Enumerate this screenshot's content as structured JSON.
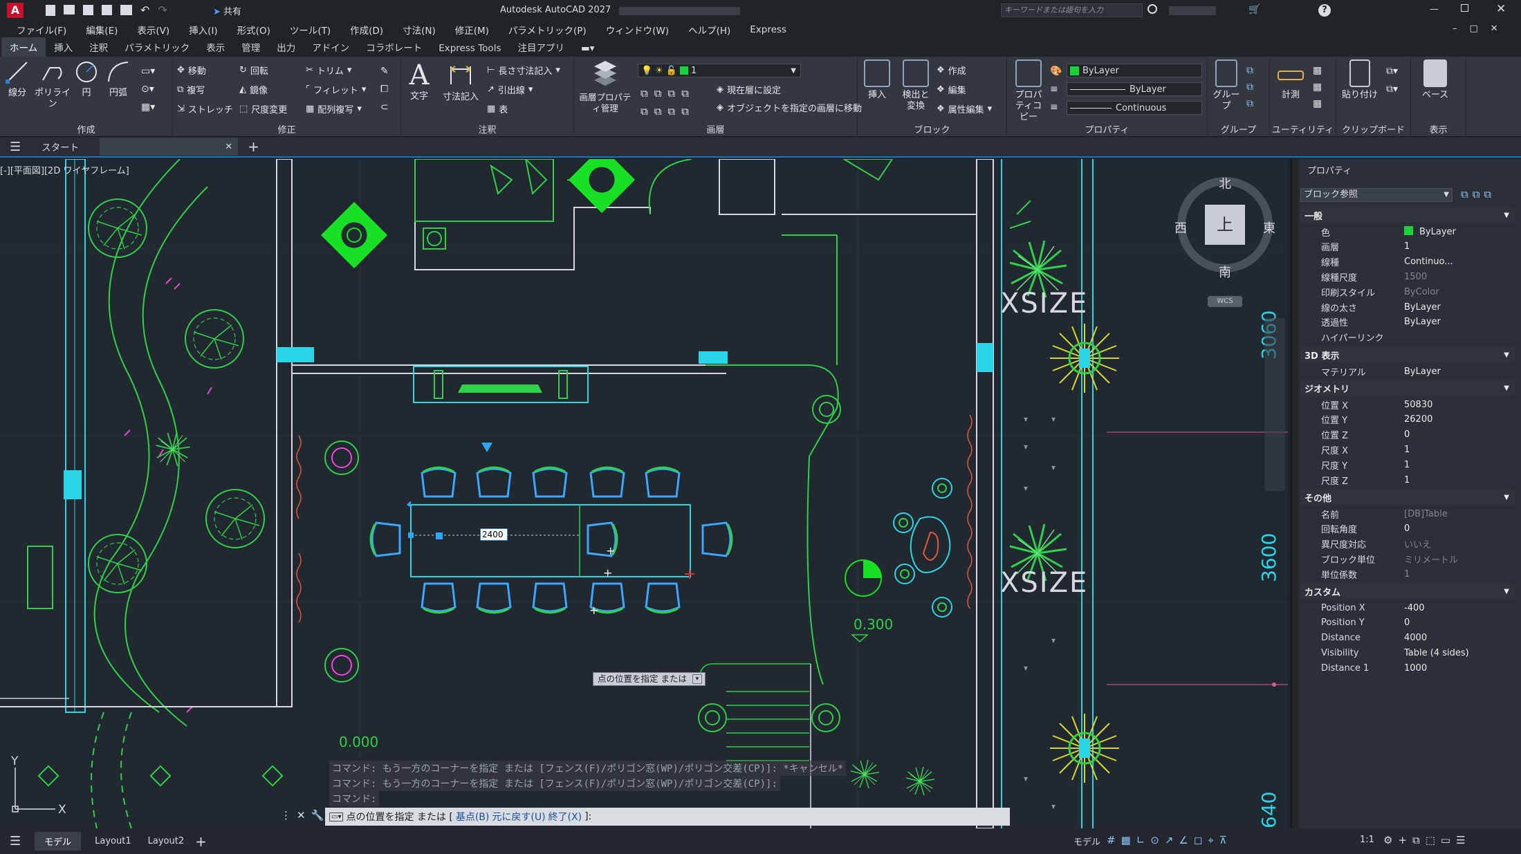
{
  "app_title": "Autodesk AutoCAD 2027",
  "share_label": "共有",
  "search_placeholder": "キーワードまたは語句を入力",
  "menu": [
    "ファイル(F)",
    "編集(E)",
    "表示(V)",
    "挿入(I)",
    "形式(O)",
    "ツール(T)",
    "作成(D)",
    "寸法(N)",
    "修正(M)",
    "パラメトリック(P)",
    "ウィンドウ(W)",
    "ヘルプ(H)",
    "Express"
  ],
  "ribbon_tabs": [
    "ホーム",
    "挿入",
    "注釈",
    "パラメトリック",
    "表示",
    "管理",
    "出力",
    "アドイン",
    "コラボレート",
    "Express Tools",
    "注目アプリ"
  ],
  "ribbon": {
    "draw": {
      "title": "作成",
      "line": "線分",
      "polyline": "ポリライン",
      "circle": "円",
      "arc": "円弧"
    },
    "modify": {
      "title": "修正",
      "move": "移動",
      "rotate": "回転",
      "trim": "トリム",
      "copy": "複写",
      "mirror": "鏡像",
      "fillet": "フィレット",
      "stretch": "ストレッチ",
      "scale": "尺度変更",
      "array": "配列複写"
    },
    "annotation": {
      "title": "注釈",
      "text": "文字",
      "dimension": "寸法記入",
      "linear": "長さ寸法記入",
      "leader": "引出線",
      "table": "表"
    },
    "layers": {
      "title": "画層",
      "layer_props": "画層プロパティ管理",
      "layer_current_value": "1",
      "set_current": "現在層に設定",
      "match_layer": "オブジェクトを指定の画層に移動"
    },
    "block": {
      "title": "ブロック",
      "insert": "挿入",
      "detect": "検出と変換",
      "create": "作成",
      "edit": "編集",
      "attr_edit": "属性編集"
    },
    "properties": {
      "title": "プロパティ",
      "match": "プロパティコピー",
      "color": "ByLayer",
      "lineweight": "ByLayer",
      "linetype": "Continuous"
    },
    "groups": {
      "title": "グループ",
      "group": "グループ"
    },
    "utilities": {
      "title": "ユーティリティ",
      "measure": "計測"
    },
    "clipboard": {
      "title": "クリップボード",
      "paste": "貼り付け"
    },
    "view": {
      "title": "表示",
      "base": "ベース"
    }
  },
  "doc_tabs": {
    "start": "スタート"
  },
  "viewport_label": "[-][平面図][2D ワイヤフレーム]",
  "viewcube": {
    "north": "北",
    "south": "南",
    "east": "東",
    "west": "西",
    "top": "上",
    "wcs": "WCS"
  },
  "drawing": {
    "dim_input": "2400",
    "tooltip": "点の位置を指定 または",
    "label_0300": "0.300",
    "label_0000": "0.000",
    "xsize1": "XSIZE",
    "xsize2": "XSIZE",
    "dim_3060": "3060",
    "dim_3600": "3600",
    "dim_640": "640",
    "ucs_x": "X",
    "ucs_y": "Y"
  },
  "command_history": [
    "コマンド: もう一方のコーナーを指定 または [フェンス(F)/ポリゴン窓(WP)/ポリゴン交差(CP)]: *キャンセル*",
    "コマンド: もう一方のコーナーを指定 または [フェンス(F)/ポリゴン窓(WP)/ポリゴン交差(CP)]:",
    "コマンド:"
  ],
  "command_prompt": {
    "text": "点の位置を指定 または [",
    "opt1": "基点(B)",
    "opt2": "元に戻す(U)",
    "opt3": "終了(X)",
    "end": "]:"
  },
  "properties": {
    "title": "プロパティ",
    "selected": "ブロック参照",
    "sections": {
      "general": "一般",
      "view3d": "3D 表示",
      "geometry": "ジオメトリ",
      "misc": "その他",
      "custom": "カスタム"
    },
    "general": [
      {
        "k": "色",
        "v": "ByLayer"
      },
      {
        "k": "画層",
        "v": "1"
      },
      {
        "k": "線種",
        "v": "Continuo..."
      },
      {
        "k": "線種尺度",
        "v": "1500"
      },
      {
        "k": "印刷スタイル",
        "v": "ByColor"
      },
      {
        "k": "線の太さ",
        "v": "ByLayer"
      },
      {
        "k": "透過性",
        "v": "ByLayer"
      },
      {
        "k": "ハイパーリンク",
        "v": ""
      }
    ],
    "view3d": [
      {
        "k": "マテリアル",
        "v": "ByLayer"
      }
    ],
    "geometry": [
      {
        "k": "位置 X",
        "v": "50830"
      },
      {
        "k": "位置 Y",
        "v": "26200"
      },
      {
        "k": "位置 Z",
        "v": "0"
      },
      {
        "k": "尺度 X",
        "v": "1"
      },
      {
        "k": "尺度 Y",
        "v": "1"
      },
      {
        "k": "尺度 Z",
        "v": "1"
      }
    ],
    "misc": [
      {
        "k": "名前",
        "v": "[DB]Table"
      },
      {
        "k": "回転角度",
        "v": "0"
      },
      {
        "k": "異尺度対応",
        "v": "いいえ"
      },
      {
        "k": "ブロック単位",
        "v": "ミリメートル"
      },
      {
        "k": "単位係数",
        "v": "1"
      }
    ],
    "custom": [
      {
        "k": "Position X",
        "v": "-400"
      },
      {
        "k": "Position Y",
        "v": "0"
      },
      {
        "k": "Distance",
        "v": "4000"
      },
      {
        "k": "Visibility",
        "v": "Table (4 sides)"
      },
      {
        "k": "Distance 1",
        "v": "1000"
      }
    ]
  },
  "status": {
    "model_tab": "モデル",
    "layout1": "Layout1",
    "layout2": "Layout2",
    "model_space": "モデル",
    "scale": "1:1"
  }
}
